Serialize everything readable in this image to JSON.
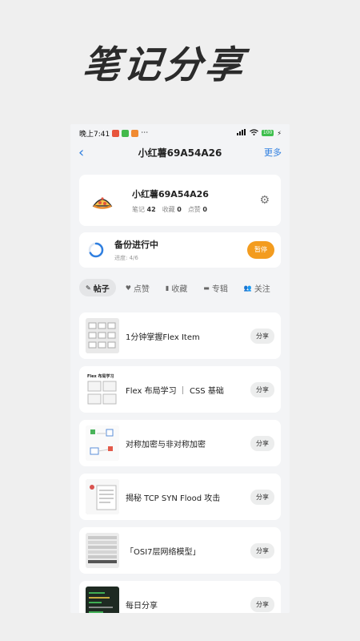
{
  "hero": {
    "title": "笔记分享"
  },
  "statusbar": {
    "time": "晚上7:41",
    "dots": "⋯",
    "battery": "100"
  },
  "navbar": {
    "back": "‹",
    "title": "小红薯69A54A26",
    "more": "更多"
  },
  "profile": {
    "name": "小红薯69A54A26",
    "notes_label": "笔记",
    "notes_value": "42",
    "fav_label": "收藏",
    "fav_value": "0",
    "like_label": "点赞",
    "like_value": "0"
  },
  "backup": {
    "title": "备份进行中",
    "progress_text": "进度: 4/6",
    "progress": 0.67,
    "pause_label": "暂停"
  },
  "tabs": [
    {
      "label": "帖子",
      "icon": "edit-icon"
    },
    {
      "label": "点赞",
      "icon": "heart-icon"
    },
    {
      "label": "收藏",
      "icon": "bookmark-icon"
    },
    {
      "label": "专辑",
      "icon": "folder-icon"
    },
    {
      "label": "关注",
      "icon": "users-icon"
    }
  ],
  "posts": [
    {
      "title": "1分钟掌握Flex Item",
      "share": "分享"
    },
    {
      "title": "Flex 布局学习 ｜ CSS 基础",
      "share": "分享",
      "thumb_text": "Flex 布局学习"
    },
    {
      "title": "对称加密与非对称加密",
      "share": "分享"
    },
    {
      "title": "揭秘 TCP SYN Flood 攻击",
      "share": "分享"
    },
    {
      "title": "「OSI7层网络模型」",
      "share": "分享"
    },
    {
      "title": "每日分享",
      "share": "分享"
    }
  ],
  "colors": {
    "accent": "#2f7fe0",
    "pause": "#f39c1f",
    "card": "#ffffff",
    "background": "#efefef"
  }
}
